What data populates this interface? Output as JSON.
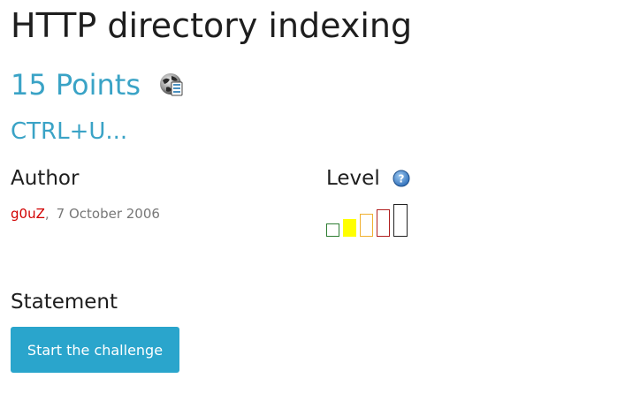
{
  "challenge": {
    "title": "HTTP directory indexing",
    "points": "15 Points",
    "category_icon": "web-server-icon",
    "subtitle": "CTRL+U..."
  },
  "author_section": {
    "heading": "Author",
    "author_name": "g0uZ",
    "separator": ",",
    "date": "7 October 2006"
  },
  "level_section": {
    "heading": "Level",
    "help_icon": "help-icon",
    "levels": [
      {
        "color": "#2e7d32",
        "filled": false
      },
      {
        "color": "#ffff00",
        "filled": true
      },
      {
        "color": "#f0b030",
        "filled": false
      },
      {
        "color": "#b02020",
        "filled": false
      },
      {
        "color": "#222222",
        "filled": false
      }
    ],
    "current_level": 2,
    "max_level": 5
  },
  "statement_section": {
    "heading": "Statement",
    "start_button_label": "Start the challenge"
  },
  "colors": {
    "accent": "#3aa3c6",
    "button_bg": "#2aa5cc",
    "author_link": "#d10000"
  }
}
